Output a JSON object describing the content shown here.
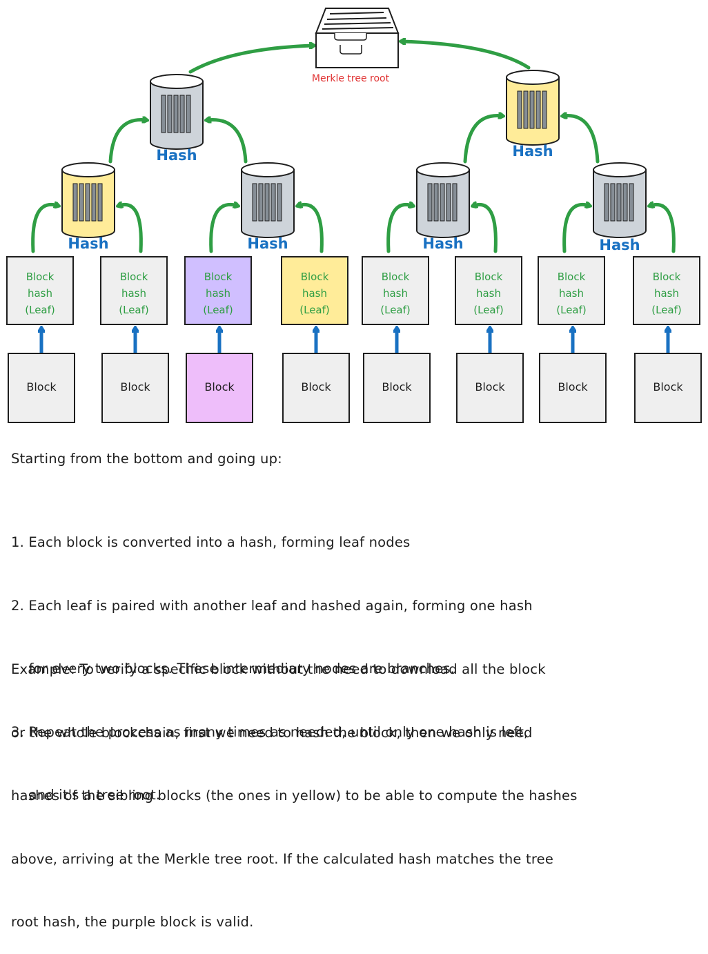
{
  "colors": {
    "arrow_green": "#2f9e44",
    "arrow_blue": "#1971c2",
    "hash_label_blue": "#1971c2",
    "leaf_text_green": "#2f9e44",
    "root_label_red": "#e03131",
    "box_gray": "#efefef",
    "cylinder_gray": "#ced4da",
    "highlight_yellow": "#ffec99",
    "leaf_purple": "#d0bfff",
    "block_purple": "#eebefa",
    "stroke": "#1e1e1e"
  },
  "root": {
    "label": "Merkle tree root",
    "icon": "file-drawer-icon"
  },
  "hash_label": "Hash",
  "branches": [
    {
      "level": 2,
      "side": "left",
      "fill": "gray",
      "icon": "barcode-cylinder-icon"
    },
    {
      "level": 2,
      "side": "right",
      "fill": "yellow",
      "icon": "barcode-cylinder-icon"
    },
    {
      "level": 1,
      "index": 0,
      "fill": "yellow",
      "icon": "barcode-cylinder-icon"
    },
    {
      "level": 1,
      "index": 1,
      "fill": "gray",
      "icon": "barcode-cylinder-icon"
    },
    {
      "level": 1,
      "index": 2,
      "fill": "gray",
      "icon": "barcode-cylinder-icon"
    },
    {
      "level": 1,
      "index": 3,
      "fill": "gray",
      "icon": "barcode-cylinder-icon"
    }
  ],
  "leaves": [
    {
      "lines": [
        "Block",
        "hash",
        "(Leaf)"
      ],
      "fill": "gray"
    },
    {
      "lines": [
        "Block",
        "hash",
        "(Leaf)"
      ],
      "fill": "gray"
    },
    {
      "lines": [
        "Block",
        "hash",
        "(Leaf)"
      ],
      "fill": "purple"
    },
    {
      "lines": [
        "Block",
        "hash",
        "(Leaf)"
      ],
      "fill": "yellow"
    },
    {
      "lines": [
        "Block",
        "hash",
        "(Leaf)"
      ],
      "fill": "gray"
    },
    {
      "lines": [
        "Block",
        "hash",
        "(Leaf)"
      ],
      "fill": "gray"
    },
    {
      "lines": [
        "Block",
        "hash",
        "(Leaf)"
      ],
      "fill": "gray"
    },
    {
      "lines": [
        "Block",
        "hash",
        "(Leaf)"
      ],
      "fill": "gray"
    }
  ],
  "blocks": [
    {
      "label": "Block",
      "fill": "gray"
    },
    {
      "label": "Block",
      "fill": "gray"
    },
    {
      "label": "Block",
      "fill": "purple"
    },
    {
      "label": "Block",
      "fill": "gray"
    },
    {
      "label": "Block",
      "fill": "gray"
    },
    {
      "label": "Block",
      "fill": "gray"
    },
    {
      "label": "Block",
      "fill": "gray"
    },
    {
      "label": "Block",
      "fill": "gray"
    }
  ],
  "text": {
    "intro": "Starting from the bottom and going up:",
    "steps": [
      "1. Each block is converted into a hash, forming leaf nodes",
      "2. Each leaf is paired with another leaf and hashed again, forming one hash",
      "    for every two blocks. These intermediary nodes are branches.",
      "3. Repeat the process as many times as needed, until only one hash is left,",
      "    and it's a tree root."
    ],
    "example": [
      "Example: To verify a specific block without the need to download all the block",
      "or the whole blockchain, first we need to hash the block, then we only need",
      "hashes of the sibling blocks (the ones in yellow) to be able to compute the hashes",
      "above, arriving at the Merkle tree root. If the calculated hash matches the tree",
      "root hash, the purple block is valid."
    ]
  }
}
